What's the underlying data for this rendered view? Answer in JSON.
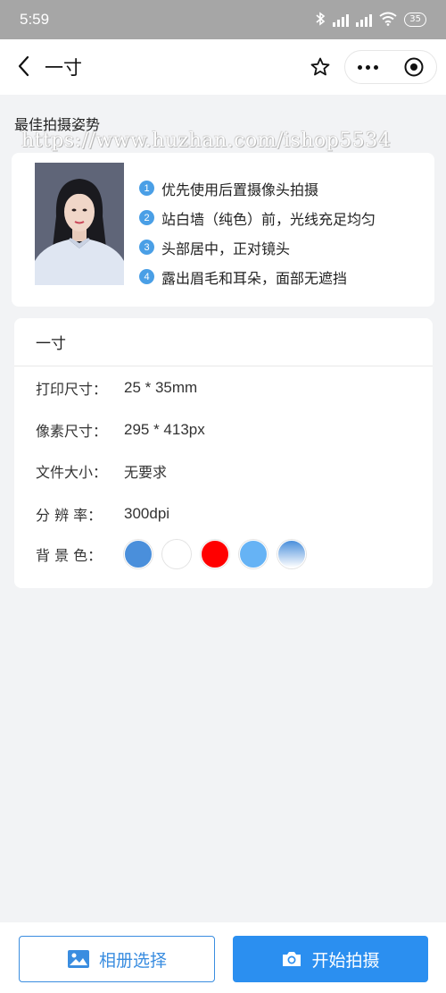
{
  "status_bar": {
    "time": "5:59",
    "battery": "35"
  },
  "nav": {
    "title": "一寸"
  },
  "section": {
    "title": "最佳拍摄姿势"
  },
  "watermark": "https://www.huzhan.com/ishop5534",
  "tips": [
    {
      "num": "1",
      "text": "优先使用后置摄像头拍摄"
    },
    {
      "num": "2",
      "text": "站白墙（纯色）前，光线充足均匀"
    },
    {
      "num": "3",
      "text": "头部居中，正对镜头"
    },
    {
      "num": "4",
      "text": "露出眉毛和耳朵，面部无遮挡"
    }
  ],
  "spec": {
    "title": "一寸",
    "print_size": {
      "label": "打印尺寸：",
      "value": "25 * 35mm"
    },
    "pixel_size": {
      "label": "像素尺寸：",
      "value": "295 * 413px"
    },
    "file_size": {
      "label": "文件大小：",
      "value": "无要求"
    },
    "resolution": {
      "label": "分 辨 率：",
      "value": "300dpi"
    },
    "background": {
      "label": "背 景 色：",
      "colors": [
        "#4a8fdb",
        "#ffffff",
        "#ff0000",
        "#66b3f5",
        "gradient-blue-white"
      ]
    }
  },
  "bottom": {
    "album_label": "相册选择",
    "shoot_label": "开始拍摄"
  },
  "colors": {
    "accent": "#2b8ff0",
    "tip_badge": "#4a9fe6",
    "page_bg": "#f2f3f5"
  }
}
